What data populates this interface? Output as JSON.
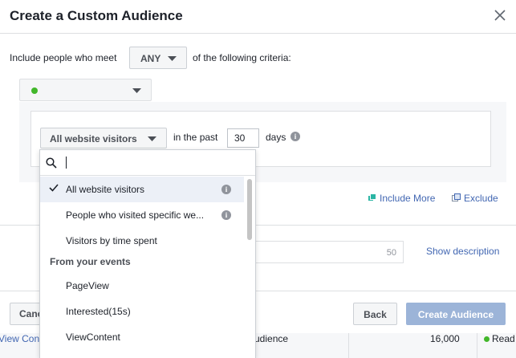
{
  "background_table": {
    "cells": [
      "View Cont",
      "udience",
      "16,000",
      "Read"
    ]
  },
  "dialog": {
    "title": "Create a Custom Audience",
    "include_prefix": "Include people who meet",
    "match_mode": "ANY",
    "include_suffix": "of the following criteria:",
    "source_status_color": "#42b72a",
    "rule": {
      "event_selector": "All website visitors",
      "in_the_past_label": "in the past",
      "days_value": "30",
      "days_label": "days"
    },
    "include_more_label": "Include More",
    "exclude_label": "Exclude",
    "audience_name_counter": "50",
    "show_description_label": "Show description",
    "footer": {
      "cancel_label": "Cancel",
      "back_label": "Back",
      "create_label": "Create Audience"
    }
  },
  "dropdown": {
    "search_placeholder": "",
    "items": [
      {
        "label": "All website visitors",
        "selected": true,
        "info": true
      },
      {
        "label": "People who visited specific we...",
        "selected": false,
        "info": true
      },
      {
        "label": "Visitors by time spent",
        "selected": false,
        "info": false
      }
    ],
    "section_title": "From your events",
    "event_items": [
      "PageView",
      "Interested(15s)",
      "ViewContent"
    ]
  },
  "colors": {
    "link": "#4267b2",
    "primary_disabled": "#9cb4d8",
    "selected_row": "#ecf0f7"
  }
}
